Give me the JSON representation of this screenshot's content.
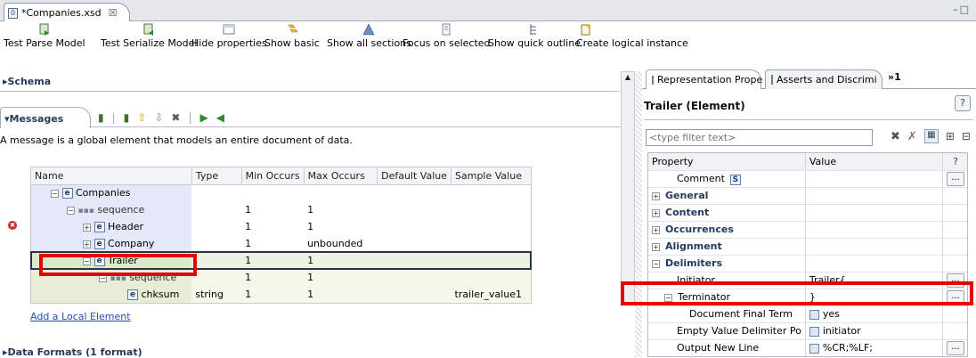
{
  "editor_tab": {
    "title": "*Companies.xsd",
    "close": "☒"
  },
  "window_controls": "–□",
  "toolbar": {
    "items": [
      {
        "label": "Test Parse Model",
        "icon": "test-parse-icon"
      },
      {
        "label": "Test Serialize Model",
        "icon": "test-serialize-icon"
      },
      {
        "label": "Hide properties",
        "icon": "hide-properties-icon"
      },
      {
        "label": "Show basic",
        "icon": "show-basic-icon"
      },
      {
        "label": "Show all sections",
        "icon": "show-all-sections-icon"
      },
      {
        "label": "Focus on selected",
        "icon": "focus-selected-icon"
      },
      {
        "label": "Show quick outline",
        "icon": "quick-outline-icon"
      },
      {
        "label": "Create logical instance",
        "icon": "create-instance-icon"
      }
    ]
  },
  "schema_section": "▸Schema",
  "messages_section": {
    "title": "▾Messages",
    "description": "A message is a global element that models an entire document of data.",
    "columns": [
      "Name",
      "Type",
      "Min Occurs",
      "Max Occurs",
      "Default Value",
      "Sample Value"
    ],
    "rows": [
      {
        "name": "Companies",
        "kind": "e",
        "type": "",
        "min": "",
        "max": "",
        "default": "",
        "sample": ""
      },
      {
        "name": "sequence",
        "kind": "seq",
        "type": "",
        "min": "1",
        "max": "1",
        "default": "",
        "sample": ""
      },
      {
        "name": "Header",
        "kind": "e",
        "type": "",
        "min": "1",
        "max": "1",
        "default": "",
        "sample": ""
      },
      {
        "name": "Company",
        "kind": "e",
        "type": "",
        "min": "1",
        "max": "unbounded",
        "default": "",
        "sample": ""
      },
      {
        "name": "Trailer",
        "kind": "e",
        "type": "",
        "min": "1",
        "max": "1",
        "default": "",
        "sample": ""
      },
      {
        "name": "sequence",
        "kind": "seq",
        "type": "",
        "min": "1",
        "max": "1",
        "default": "",
        "sample": ""
      },
      {
        "name": "chksum",
        "kind": "e",
        "type": "string",
        "min": "1",
        "max": "1",
        "default": "",
        "sample": "trailer_value1"
      }
    ],
    "add_link": "Add a Local Element"
  },
  "data_formats_section": "▸Data Formats (1 format)",
  "right_panel": {
    "tabs": [
      "Representation Prope",
      "Asserts and Discrimi",
      "»1"
    ],
    "title": "Trailer (Element)",
    "help": "?",
    "filter_placeholder": "<type filter text>",
    "columns": [
      "Property",
      "Value",
      "?"
    ],
    "rows": [
      {
        "property": "Comment",
        "value": "",
        "indent": 2,
        "expand": "",
        "button": true,
        "badge": "S",
        "bold": false
      },
      {
        "property": "General",
        "value": "",
        "indent": 0,
        "expand": "+",
        "button": false,
        "badge": "",
        "bold": true
      },
      {
        "property": "Content",
        "value": "",
        "indent": 0,
        "expand": "+",
        "button": false,
        "badge": "",
        "bold": true
      },
      {
        "property": "Occurrences",
        "value": "",
        "indent": 0,
        "expand": "+",
        "button": false,
        "badge": "",
        "bold": true
      },
      {
        "property": "Alignment",
        "value": "",
        "indent": 0,
        "expand": "+",
        "button": false,
        "badge": "",
        "bold": true
      },
      {
        "property": "Delimiters",
        "value": "",
        "indent": 0,
        "expand": "−",
        "button": false,
        "badge": "",
        "bold": true
      },
      {
        "property": "Initiator",
        "value": "Trailer{",
        "indent": 2,
        "expand": "",
        "button": true,
        "badge": "",
        "bold": false
      },
      {
        "property": "Terminator",
        "value": "}",
        "indent": 1,
        "expand": "−",
        "button": true,
        "badge": "",
        "bold": false
      },
      {
        "property": "Document Final Term",
        "value": "yes",
        "indent": 3,
        "expand": "",
        "button": false,
        "badge": "",
        "bold": false
      },
      {
        "property": "Empty Value Delimiter Po",
        "value": "initiator",
        "indent": 2,
        "expand": "",
        "button": false,
        "badge": "",
        "bold": false
      },
      {
        "property": "Output New Line",
        "value": "%CR;%LF;",
        "indent": 2,
        "expand": "",
        "button": true,
        "badge": "",
        "bold": false
      }
    ],
    "button_label": "..."
  }
}
